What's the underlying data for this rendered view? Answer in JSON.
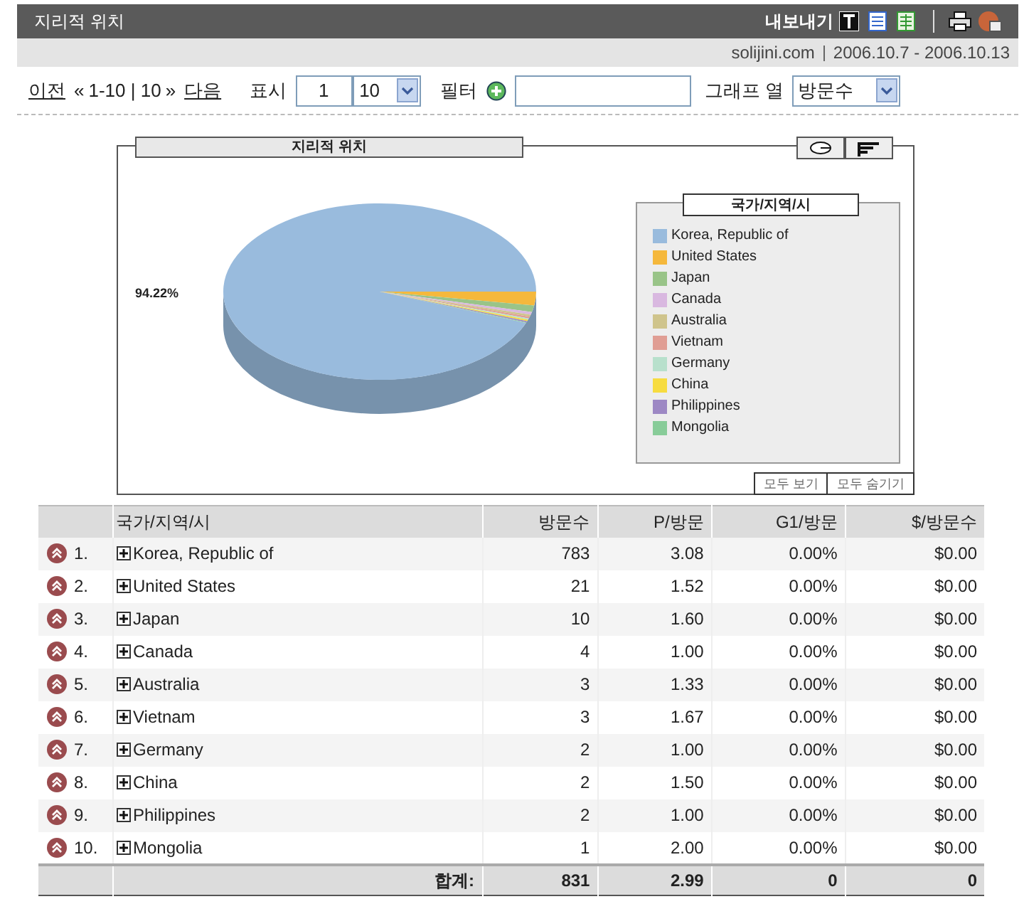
{
  "header": {
    "title": "지리적 위치",
    "export_label": "내보내기"
  },
  "subheader": {
    "site": "solijini.com",
    "date_range": "2006.10.7 - 2006.10.13"
  },
  "toolbar": {
    "prev": "이전",
    "prev_arrows": "«",
    "range": "1-10 | 10",
    "next_arrows": "»",
    "next": "다음",
    "show_label": "표시",
    "start_value": "1",
    "count_value": "10",
    "filter_label": "필터",
    "graph_label": "그래프 열",
    "graph_value": "방문수"
  },
  "chart_panel": {
    "title": "지리적 위치",
    "legend_title": "국가/지역/시",
    "show_all": "모두 보기",
    "hide_all": "모두 숨기기",
    "pie_label": "94.22%",
    "legend": [
      {
        "label": "Korea, Republic of",
        "color": "#99bbdd"
      },
      {
        "label": "United States",
        "color": "#f5b83c"
      },
      {
        "label": "Japan",
        "color": "#99c488"
      },
      {
        "label": "Canada",
        "color": "#d9b8e0"
      },
      {
        "label": "Australia",
        "color": "#cfc48c"
      },
      {
        "label": "Vietnam",
        "color": "#e09e94"
      },
      {
        "label": "Germany",
        "color": "#b8e0cc"
      },
      {
        "label": "China",
        "color": "#f7dc40"
      },
      {
        "label": "Philippines",
        "color": "#9d88c4"
      },
      {
        "label": "Mongolia",
        "color": "#88cc99"
      }
    ]
  },
  "table": {
    "columns": [
      "국가/지역/시",
      "방문수",
      "P/방문",
      "G1/방문",
      "$/방문수"
    ],
    "rows": [
      {
        "rank": "1.",
        "name": "Korea, Republic of",
        "visits": "783",
        "pages": "3.08",
        "goal": "0.00%",
        "revenue": "$0.00"
      },
      {
        "rank": "2.",
        "name": "United States",
        "visits": "21",
        "pages": "1.52",
        "goal": "0.00%",
        "revenue": "$0.00"
      },
      {
        "rank": "3.",
        "name": "Japan",
        "visits": "10",
        "pages": "1.60",
        "goal": "0.00%",
        "revenue": "$0.00"
      },
      {
        "rank": "4.",
        "name": "Canada",
        "visits": "4",
        "pages": "1.00",
        "goal": "0.00%",
        "revenue": "$0.00"
      },
      {
        "rank": "5.",
        "name": "Australia",
        "visits": "3",
        "pages": "1.33",
        "goal": "0.00%",
        "revenue": "$0.00"
      },
      {
        "rank": "6.",
        "name": "Vietnam",
        "visits": "3",
        "pages": "1.67",
        "goal": "0.00%",
        "revenue": "$0.00"
      },
      {
        "rank": "7.",
        "name": "Germany",
        "visits": "2",
        "pages": "1.00",
        "goal": "0.00%",
        "revenue": "$0.00"
      },
      {
        "rank": "8.",
        "name": "China",
        "visits": "2",
        "pages": "1.50",
        "goal": "0.00%",
        "revenue": "$0.00"
      },
      {
        "rank": "9.",
        "name": "Philippines",
        "visits": "2",
        "pages": "1.00",
        "goal": "0.00%",
        "revenue": "$0.00"
      },
      {
        "rank": "10.",
        "name": "Mongolia",
        "visits": "1",
        "pages": "2.00",
        "goal": "0.00%",
        "revenue": "$0.00"
      }
    ],
    "total": {
      "label": "합계:",
      "visits": "831",
      "pages": "2.99",
      "goal": "0",
      "revenue": "0"
    }
  }
}
